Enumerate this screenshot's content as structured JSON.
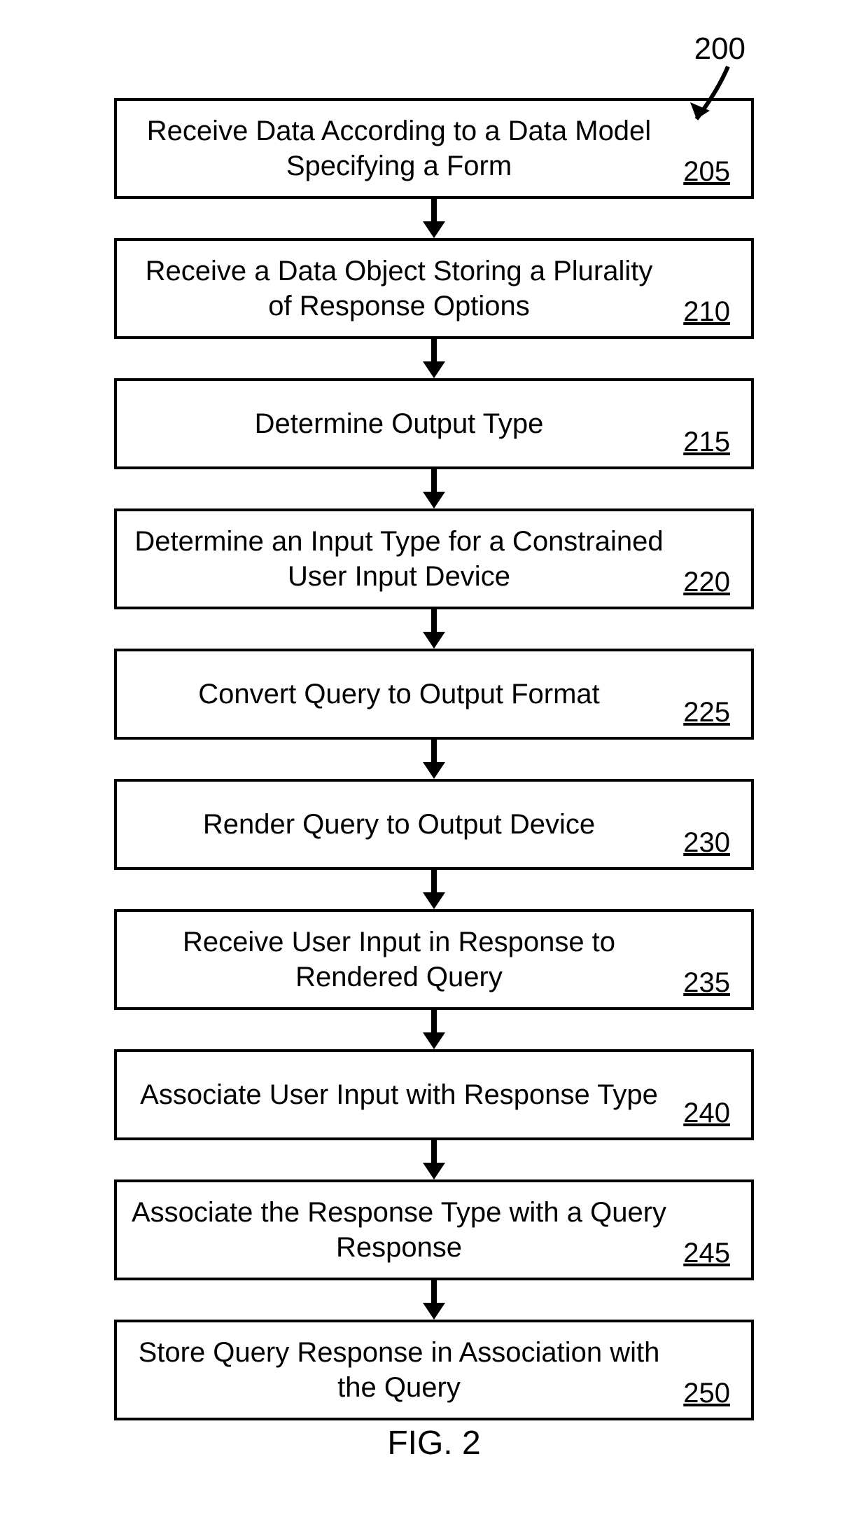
{
  "figure_label": "FIG. 2",
  "reference_number": "200",
  "steps": [
    {
      "label": "Receive Data According to a Data Model Specifying a Form",
      "num": "205"
    },
    {
      "label": "Receive a Data Object Storing a Plurality of Response Options",
      "num": "210"
    },
    {
      "label": "Determine Output Type",
      "num": "215"
    },
    {
      "label": "Determine an Input Type for a Constrained User Input Device",
      "num": "220"
    },
    {
      "label": "Convert Query to Output Format",
      "num": "225"
    },
    {
      "label": "Render Query to Output Device",
      "num": "230"
    },
    {
      "label": "Receive User Input in Response to Rendered Query",
      "num": "235"
    },
    {
      "label": "Associate User Input with Response Type",
      "num": "240"
    },
    {
      "label": "Associate the Response Type with a Query Response",
      "num": "245"
    },
    {
      "label": "Store Query Response in Association with the Query",
      "num": "250"
    }
  ]
}
